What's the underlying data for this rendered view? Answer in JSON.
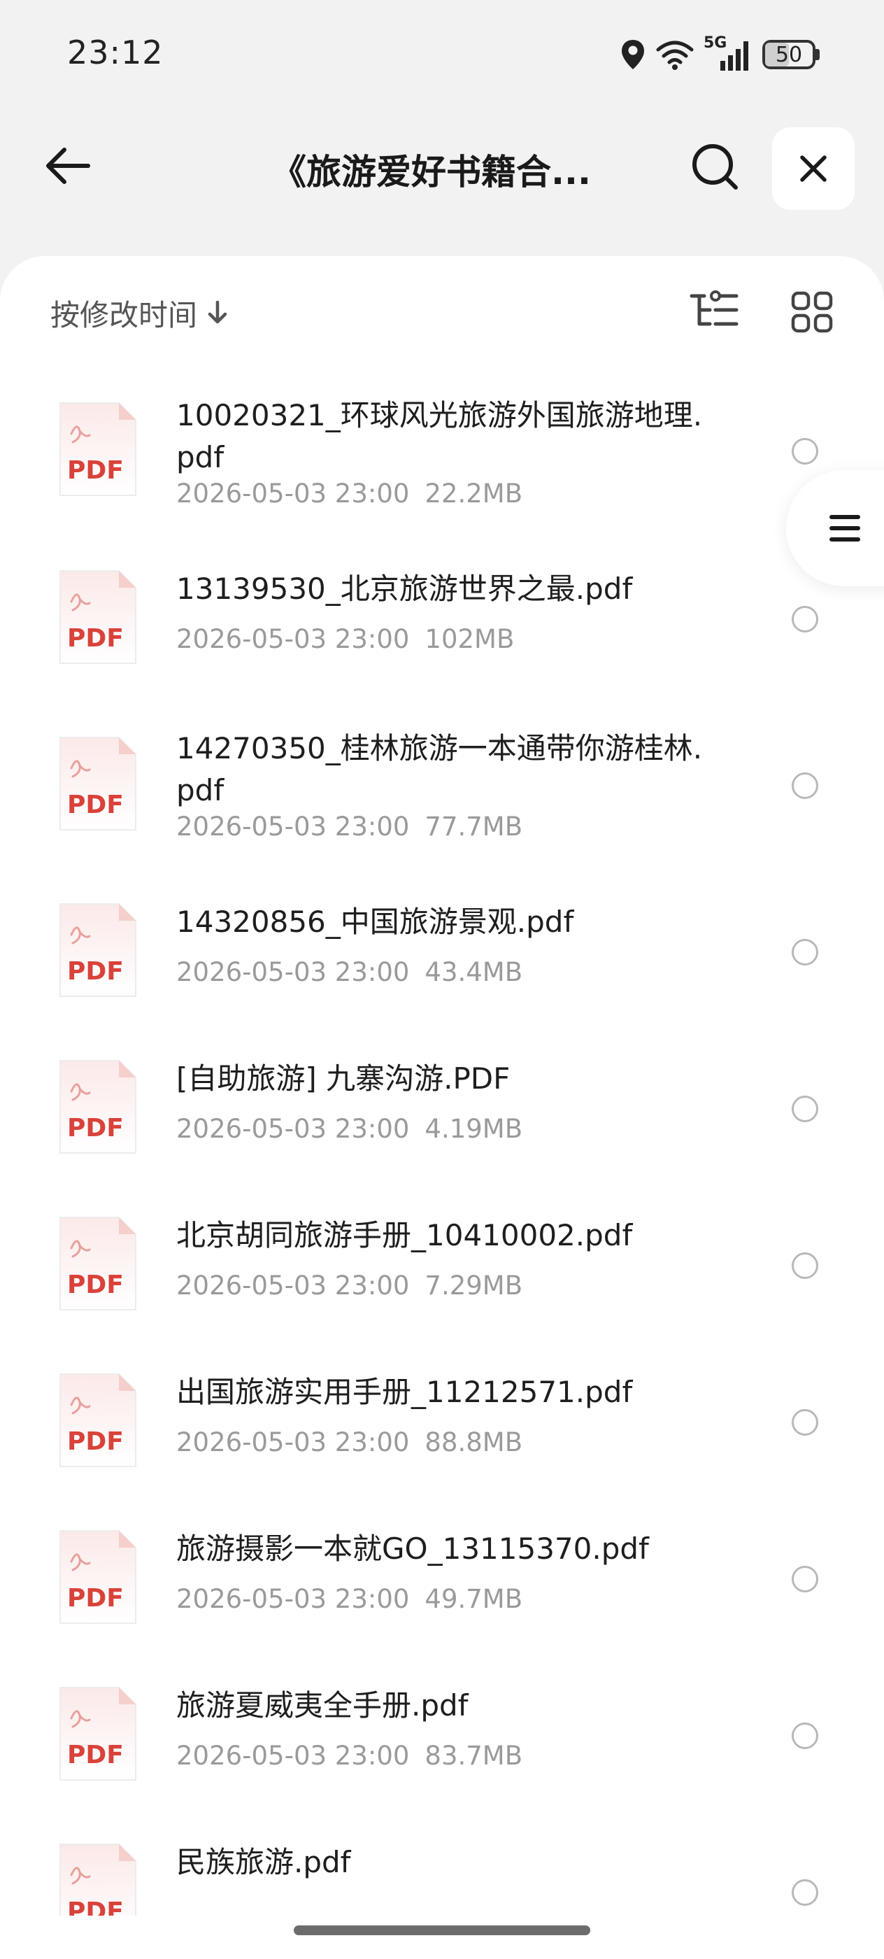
{
  "status_bar": {
    "time": "23:12",
    "network": "5G",
    "battery_level": "50",
    "battery_fraction": 0.5,
    "icons": [
      "location-icon",
      "wifi-icon",
      "signal-icon",
      "battery-icon"
    ]
  },
  "header": {
    "title": "《旅游爱好书籍合...",
    "back_icon": "back-arrow-icon",
    "search_icon": "search-icon",
    "close_icon": "close-icon"
  },
  "toolbar": {
    "sort_label": "按修改时间",
    "sort_icon": "arrow-down-icon",
    "tree_icon": "tree-view-icon",
    "grid_icon": "grid-view-icon"
  },
  "side_handle_icon": "menu-icon",
  "files": [
    {
      "name": "10020321_环球风光旅游外国旅游地理.pdf",
      "date": "2026-05-03 23:00",
      "size": "22.2MB",
      "icon_label": "PDF"
    },
    {
      "name": "13139530_北京旅游世界之最.pdf",
      "date": "2026-05-03 23:00",
      "size": "102MB",
      "icon_label": "PDF"
    },
    {
      "name": "14270350_桂林旅游一本通带你游桂林.pdf",
      "date": "2026-05-03 23:00",
      "size": "77.7MB",
      "icon_label": "PDF"
    },
    {
      "name": "14320856_中国旅游景观.pdf",
      "date": "2026-05-03 23:00",
      "size": "43.4MB",
      "icon_label": "PDF"
    },
    {
      "name": "[自助旅游] 九寨沟游.PDF",
      "date": "2026-05-03 23:00",
      "size": "4.19MB",
      "icon_label": "PDF"
    },
    {
      "name": "北京胡同旅游手册_10410002.pdf",
      "date": "2026-05-03 23:00",
      "size": "7.29MB",
      "icon_label": "PDF"
    },
    {
      "name": "出国旅游实用手册_11212571.pdf",
      "date": "2026-05-03 23:00",
      "size": "88.8MB",
      "icon_label": "PDF"
    },
    {
      "name": "旅游摄影一本就GO_13115370.pdf",
      "date": "2026-05-03 23:00",
      "size": "49.7MB",
      "icon_label": "PDF"
    },
    {
      "name": "旅游夏威夷全手册.pdf",
      "date": "2026-05-03 23:00",
      "size": "83.7MB",
      "icon_label": "PDF"
    },
    {
      "name": "民族旅游.pdf",
      "date": "",
      "size": "",
      "icon_label": "PDF"
    }
  ],
  "colors": {
    "background": "#f2f2f2",
    "sheet": "#ffffff",
    "pdf_red": "#d9423a",
    "meta_gray": "#9a9a9a"
  }
}
